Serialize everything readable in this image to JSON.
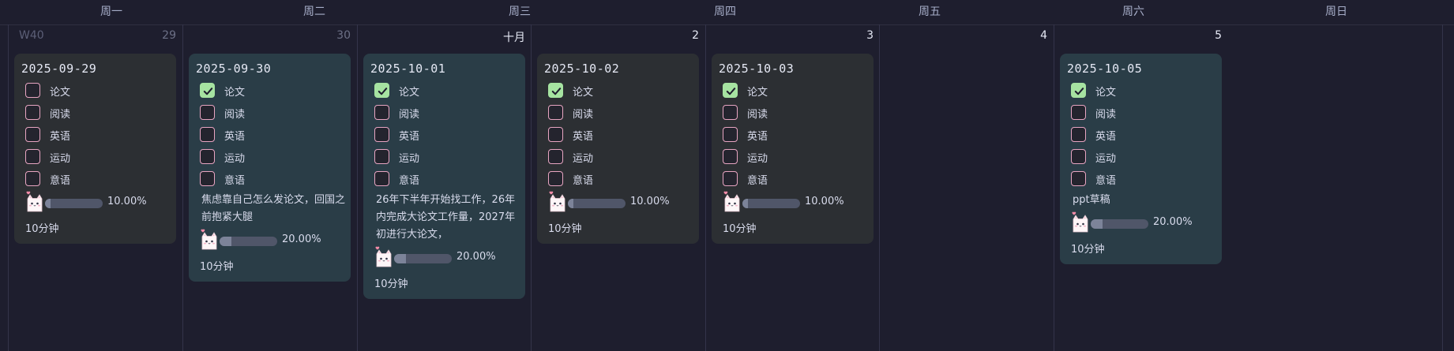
{
  "weekdays": [
    "周一",
    "周二",
    "周三",
    "周四",
    "周五",
    "周六",
    "周日"
  ],
  "week_label": "W40",
  "days": [
    {
      "num": "29",
      "style": "dim",
      "card": {
        "color": "gray",
        "date": "2025-09-29",
        "note": "",
        "progress_text": "10.00%",
        "progress": 0.1,
        "duration": "10分钟",
        "tasks": [
          {
            "label": "论文",
            "checked": false
          },
          {
            "label": "阅读",
            "checked": false
          },
          {
            "label": "英语",
            "checked": false
          },
          {
            "label": "运动",
            "checked": false
          },
          {
            "label": "意语",
            "checked": false
          }
        ]
      }
    },
    {
      "num": "30",
      "style": "dim",
      "card": {
        "color": "slate",
        "date": "2025-09-30",
        "note": "焦虑靠自己怎么发论文，回国之前抱紧大腿",
        "progress_text": "20.00%",
        "progress": 0.2,
        "duration": "10分钟",
        "tasks": [
          {
            "label": "论文",
            "checked": true
          },
          {
            "label": "阅读",
            "checked": false
          },
          {
            "label": "英语",
            "checked": false
          },
          {
            "label": "运动",
            "checked": false
          },
          {
            "label": "意语",
            "checked": false
          }
        ]
      }
    },
    {
      "num": "十月",
      "style": "bright",
      "card": {
        "color": "slate",
        "date": "2025-10-01",
        "note": "26年下半年开始找工作，26年内完成大论文工作量，2027年初进行大论文，",
        "progress_text": "20.00%",
        "progress": 0.2,
        "duration": "10分钟",
        "tasks": [
          {
            "label": "论文",
            "checked": true
          },
          {
            "label": "阅读",
            "checked": false
          },
          {
            "label": "英语",
            "checked": false
          },
          {
            "label": "运动",
            "checked": false
          },
          {
            "label": "意语",
            "checked": false
          }
        ]
      }
    },
    {
      "num": "2",
      "style": "bright",
      "card": {
        "color": "gray",
        "date": "2025-10-02",
        "note": "",
        "progress_text": "10.00%",
        "progress": 0.1,
        "duration": "10分钟",
        "tasks": [
          {
            "label": "论文",
            "checked": true
          },
          {
            "label": "阅读",
            "checked": false
          },
          {
            "label": "英语",
            "checked": false
          },
          {
            "label": "运动",
            "checked": false
          },
          {
            "label": "意语",
            "checked": false
          }
        ]
      }
    },
    {
      "num": "3",
      "style": "bright",
      "card": {
        "color": "gray",
        "date": "2025-10-03",
        "note": "",
        "progress_text": "10.00%",
        "progress": 0.1,
        "duration": "10分钟",
        "tasks": [
          {
            "label": "论文",
            "checked": true
          },
          {
            "label": "阅读",
            "checked": false
          },
          {
            "label": "英语",
            "checked": false
          },
          {
            "label": "运动",
            "checked": false
          },
          {
            "label": "意语",
            "checked": false
          }
        ]
      }
    },
    {
      "num": "4",
      "style": "bright",
      "card": null
    },
    {
      "num": "5",
      "style": "bright",
      "card": {
        "color": "slate",
        "date": "2025-10-05",
        "note": "ppt草稿",
        "progress_text": "20.00%",
        "progress": 0.2,
        "duration": "10分钟",
        "tasks": [
          {
            "label": "论文",
            "checked": true
          },
          {
            "label": "阅读",
            "checked": false
          },
          {
            "label": "英语",
            "checked": false
          },
          {
            "label": "运动",
            "checked": false
          },
          {
            "label": "意语",
            "checked": false
          }
        ]
      }
    }
  ],
  "icons": {
    "checkmark": "check-icon",
    "progress_cat": "cat-icon"
  },
  "colors": {
    "card_gray": "#2c2f33",
    "card_slate": "#2a3d47",
    "check_fill": "#a6e3a1",
    "checkbox_border": "#e8a5c2",
    "background": "#1e1e2e"
  }
}
